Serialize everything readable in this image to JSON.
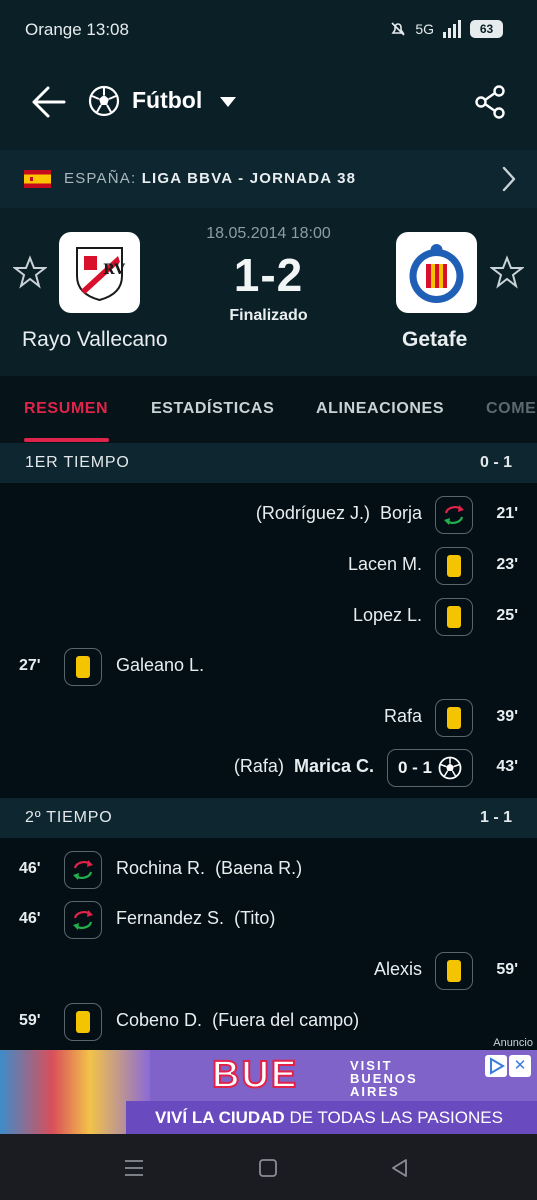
{
  "status_bar": {
    "carrier_time": "Orange 13:08",
    "network": "5G",
    "battery": "63"
  },
  "app_bar": {
    "sport": "Fútbol"
  },
  "league": {
    "country": "ESPAÑA:",
    "competition": "LIGA BBVA - JORNADA 38"
  },
  "match": {
    "date": "18.05.2014 18:00",
    "score": "1-2",
    "status": "Finalizado",
    "home": {
      "name": "Rayo Vallecano"
    },
    "away": {
      "name": "Getafe"
    }
  },
  "tabs": [
    "RESUMEN",
    "ESTADÍSTICAS",
    "ALINEACIONES",
    "COME"
  ],
  "first_half": {
    "title": "1ER TIEMPO",
    "score": "0 - 1",
    "events": [
      {
        "minute": "21'",
        "assist": "(Rodríguez J.)",
        "player": "Borja",
        "icon": "substitution-icon"
      },
      {
        "minute": "23'",
        "player": "Lacen M.",
        "icon": "yellow-card-icon"
      },
      {
        "minute": "25'",
        "player": "Lopez L.",
        "icon": "yellow-card-icon"
      },
      {
        "minute": "27'",
        "player": "Galeano L.",
        "icon": "yellow-card-icon"
      },
      {
        "minute": "39'",
        "player": "Rafa",
        "icon": "yellow-card-icon"
      },
      {
        "minute": "43'",
        "assist": "(Rafa)",
        "player": "Marica C.",
        "goal_score": "0 - 1",
        "icon": "soccer-ball-icon"
      }
    ]
  },
  "second_half": {
    "title": "2º TIEMPO",
    "score": "1 - 1",
    "events": [
      {
        "minute": "46'",
        "player": "Rochina R.",
        "detail": "(Baena R.)",
        "icon": "substitution-icon"
      },
      {
        "minute": "46'",
        "player": "Fernandez S.",
        "detail": "(Tito)",
        "icon": "substitution-icon"
      },
      {
        "minute": "59'",
        "player": "Alexis",
        "icon": "yellow-card-icon"
      },
      {
        "minute": "59'",
        "player": "Cobeno D.",
        "detail": "(Fuera del campo)",
        "icon": "yellow-card-icon"
      }
    ]
  },
  "ad": {
    "label": "Anuncio",
    "brand": "BUE",
    "visit_line1": "VISIT",
    "visit_line2": "BUENOS",
    "visit_line3": "AIRES",
    "tagline_bold": "VIVÍ LA CIUDAD",
    "tagline_rest": " DE TODAS LAS PASIONES"
  },
  "colors": {
    "accent": "#e0234a",
    "background": "#030f15",
    "header": "#0b1f27",
    "yellow_card": "#f5c400"
  }
}
